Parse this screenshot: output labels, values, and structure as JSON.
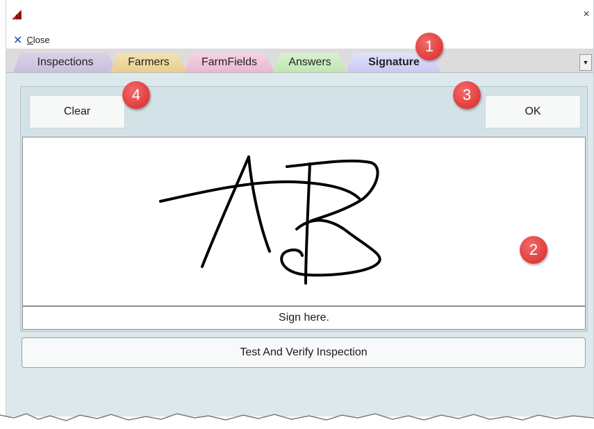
{
  "window": {
    "close_glyph": "×"
  },
  "menu": {
    "close_label": "Close",
    "close_icon": "close-x-icon"
  },
  "tabs": [
    {
      "label": "Inspections",
      "color": "#d9d2e6"
    },
    {
      "label": "Farmers",
      "color": "#f5e2b3"
    },
    {
      "label": "FarmFields",
      "color": "#f6d3e3"
    },
    {
      "label": "Answers",
      "color": "#d8f2cf"
    },
    {
      "label": "Signature",
      "color": "#e2e2fb",
      "active": true
    }
  ],
  "signature": {
    "clear_label": "Clear",
    "ok_label": "OK",
    "sign_prompt": "Sign here."
  },
  "verify_label": "Test And Verify Inspection",
  "callouts": [
    "1",
    "2",
    "3",
    "4"
  ],
  "colors": {
    "callout": "#d92828",
    "window_bg": "#dde8ec",
    "accent": "#1f4fa8"
  }
}
